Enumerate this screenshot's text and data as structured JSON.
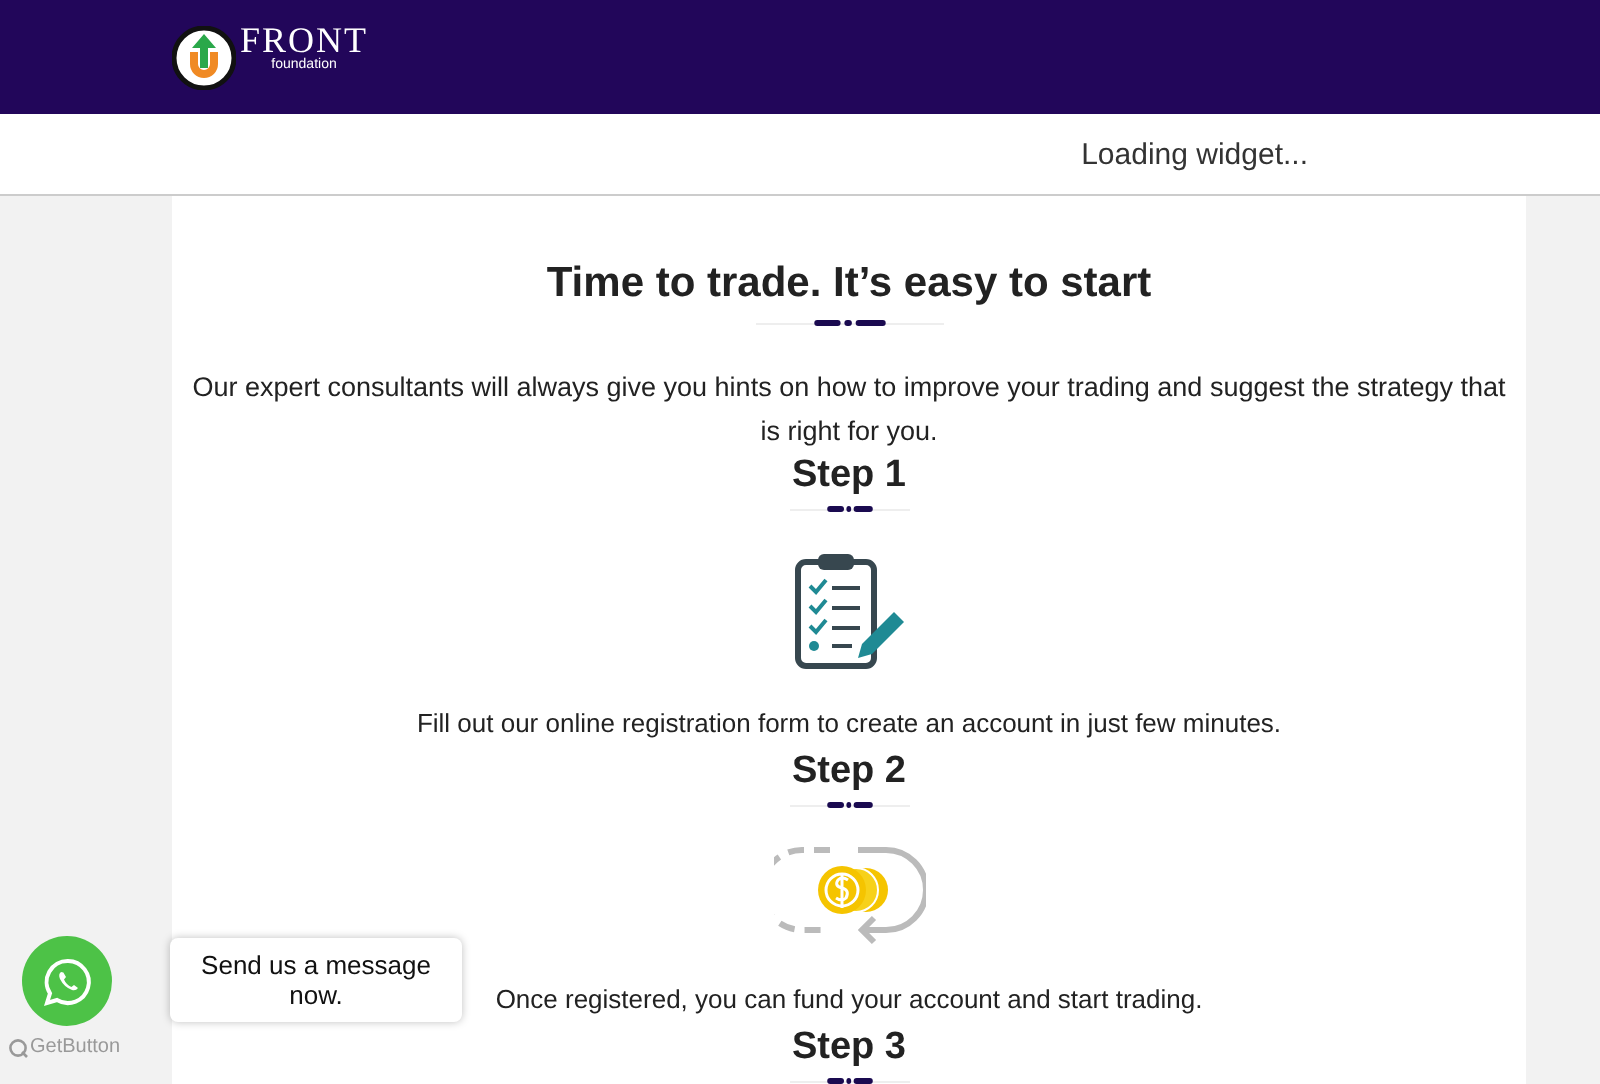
{
  "header": {
    "logo_word": "FRONT",
    "logo_sub": "foundation"
  },
  "widget_bar": {
    "text": "Loading widget..."
  },
  "intro": {
    "title": "Time to trade. It’s easy to start",
    "text": "Our expert consultants will always give you hints on how to improve your trading and suggest the strategy that is right for you."
  },
  "steps": [
    {
      "title": "Step 1",
      "kind": "clipboard",
      "text": "Fill out our online registration form to create an account in just few minutes."
    },
    {
      "title": "Step 2",
      "kind": "coins",
      "text": "Once registered, you can fund your account and start trading."
    },
    {
      "title": "Step 3",
      "kind": "none"
    }
  ],
  "chat": {
    "tooltip": "Send us a message now.",
    "brand": "GetButton"
  }
}
